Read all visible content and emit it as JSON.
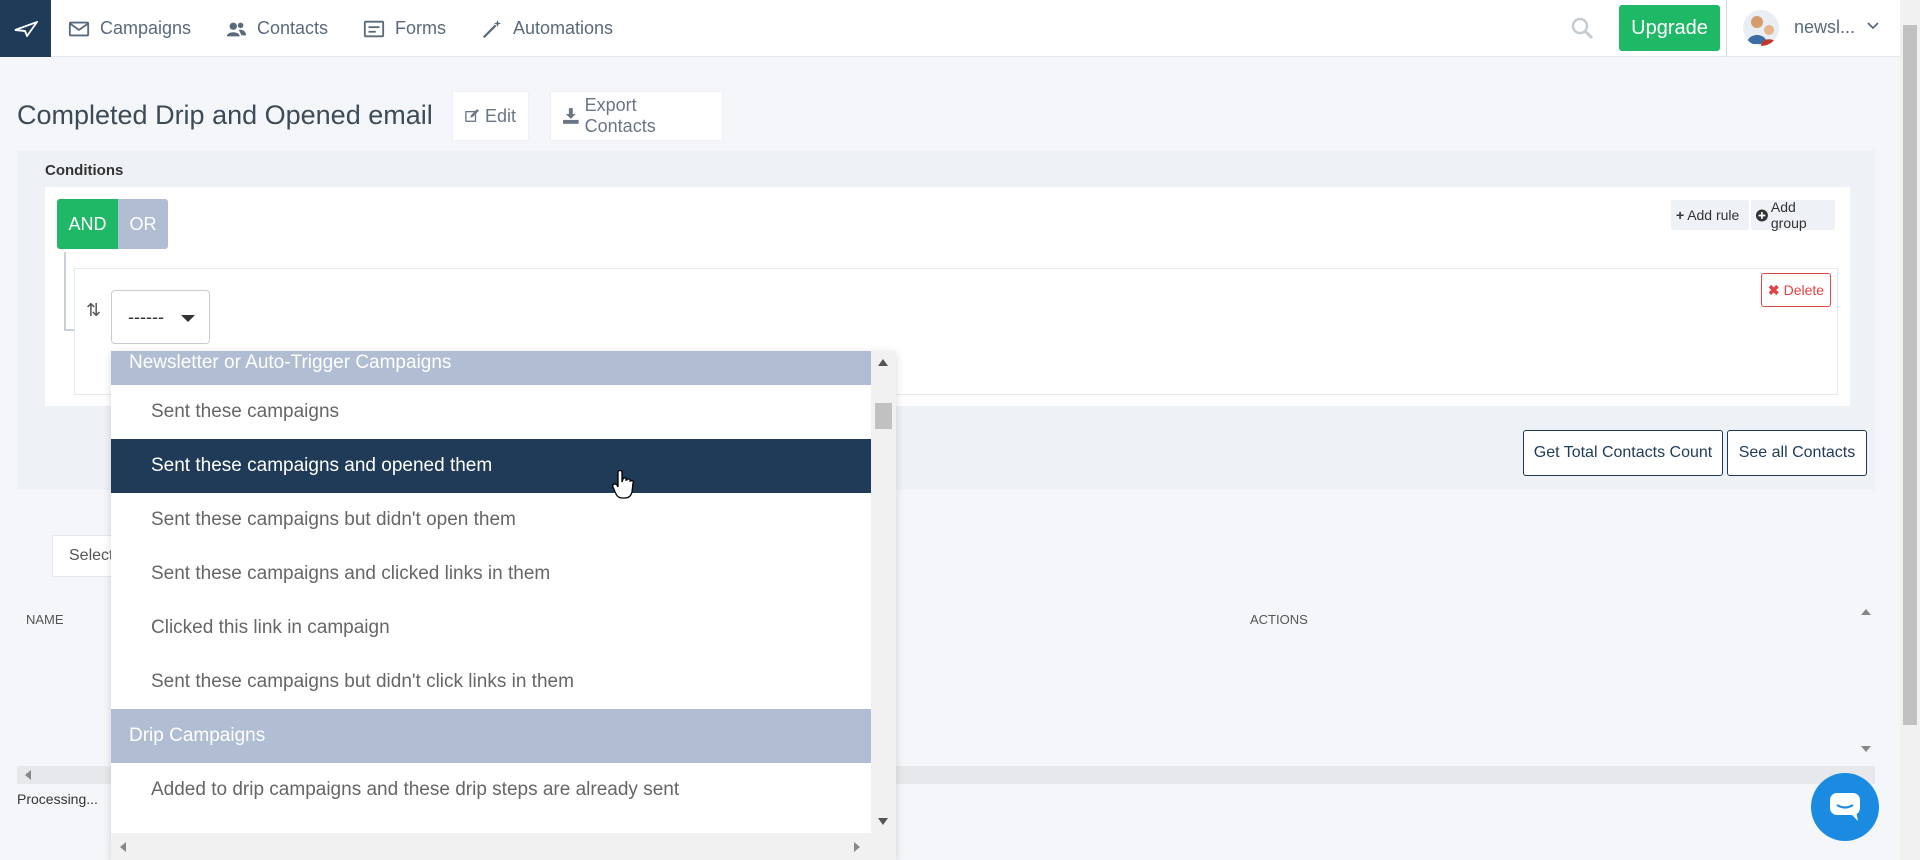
{
  "nav": {
    "items": [
      {
        "label": "Campaigns",
        "icon": "envelope-icon"
      },
      {
        "label": "Contacts",
        "icon": "users-icon"
      },
      {
        "label": "Forms",
        "icon": "form-icon"
      },
      {
        "label": "Automations",
        "icon": "magic-wand-icon"
      }
    ],
    "upgrade_label": "Upgrade",
    "user_name": "newsl..."
  },
  "page": {
    "title": "Completed Drip and Opened email",
    "edit_label": "Edit",
    "export_label": "Export Contacts"
  },
  "conditions": {
    "label": "Conditions",
    "and_label": "AND",
    "or_label": "OR",
    "add_rule_label": "Add rule",
    "add_group_label": "Add group",
    "delete_label": "Delete",
    "select_value": "------",
    "total_count_label": "Get Total Contacts Count",
    "see_all_label": "See all Contacts"
  },
  "table": {
    "filter_placeholder": "Select",
    "col_name": "NAME",
    "col_actions": "ACTIONS",
    "processing": "Processing..."
  },
  "dropdown": {
    "group1": "Newsletter or Auto-Trigger Campaigns",
    "options1": [
      "Sent these campaigns",
      "Sent these campaigns and opened them",
      "Sent these campaigns but didn't open them",
      "Sent these campaigns and clicked links in them",
      "Clicked this link in campaign",
      "Sent these campaigns but didn't click links in them"
    ],
    "selected_index": 1,
    "group2": "Drip Campaigns",
    "options2": [
      "Added to drip campaigns and these drip steps are already sent"
    ]
  },
  "colors": {
    "brand_dark": "#1f3b57",
    "green": "#1fb866",
    "group_bg": "#b0bdd2",
    "danger": "#e04444",
    "chat": "#1a8be0"
  }
}
